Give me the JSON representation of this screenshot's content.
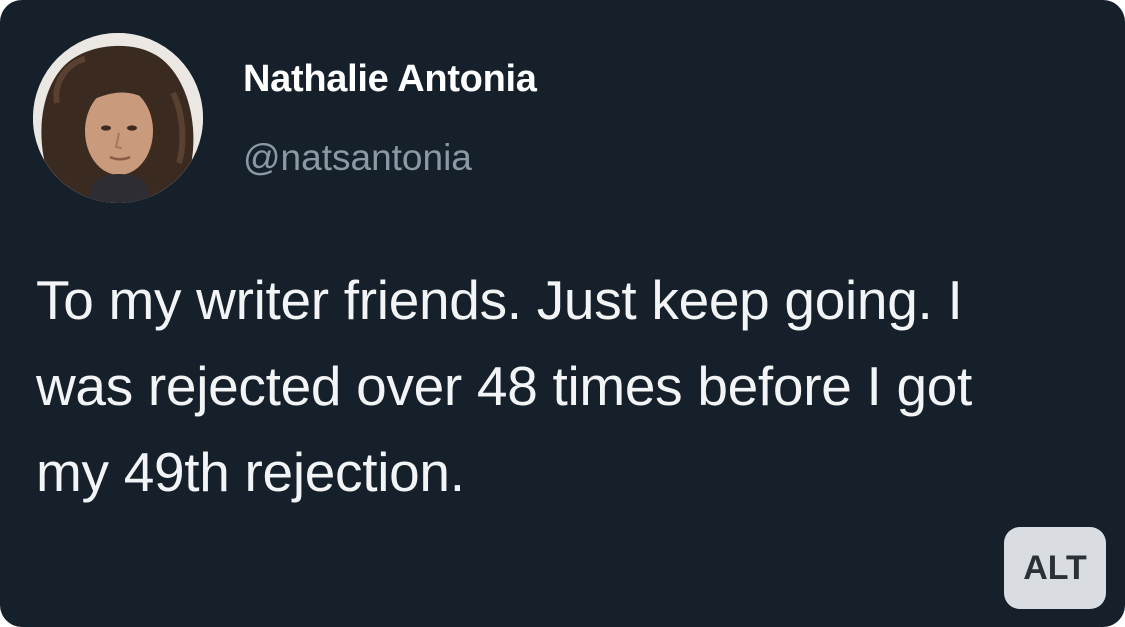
{
  "tweet": {
    "author": {
      "display_name": "Nathalie Antonia",
      "handle": "@natsantonia",
      "avatar_icon": "profile-photo"
    },
    "text": "To my writer friends. Just keep going. I was rejected over 48 times before I got my 49th rejection.",
    "alt_badge": "ALT"
  },
  "colors": {
    "background": "#15202b",
    "text": "#f2f4f5",
    "handle": "#8b98a5",
    "alt_badge_bg": "#d9dde1"
  }
}
